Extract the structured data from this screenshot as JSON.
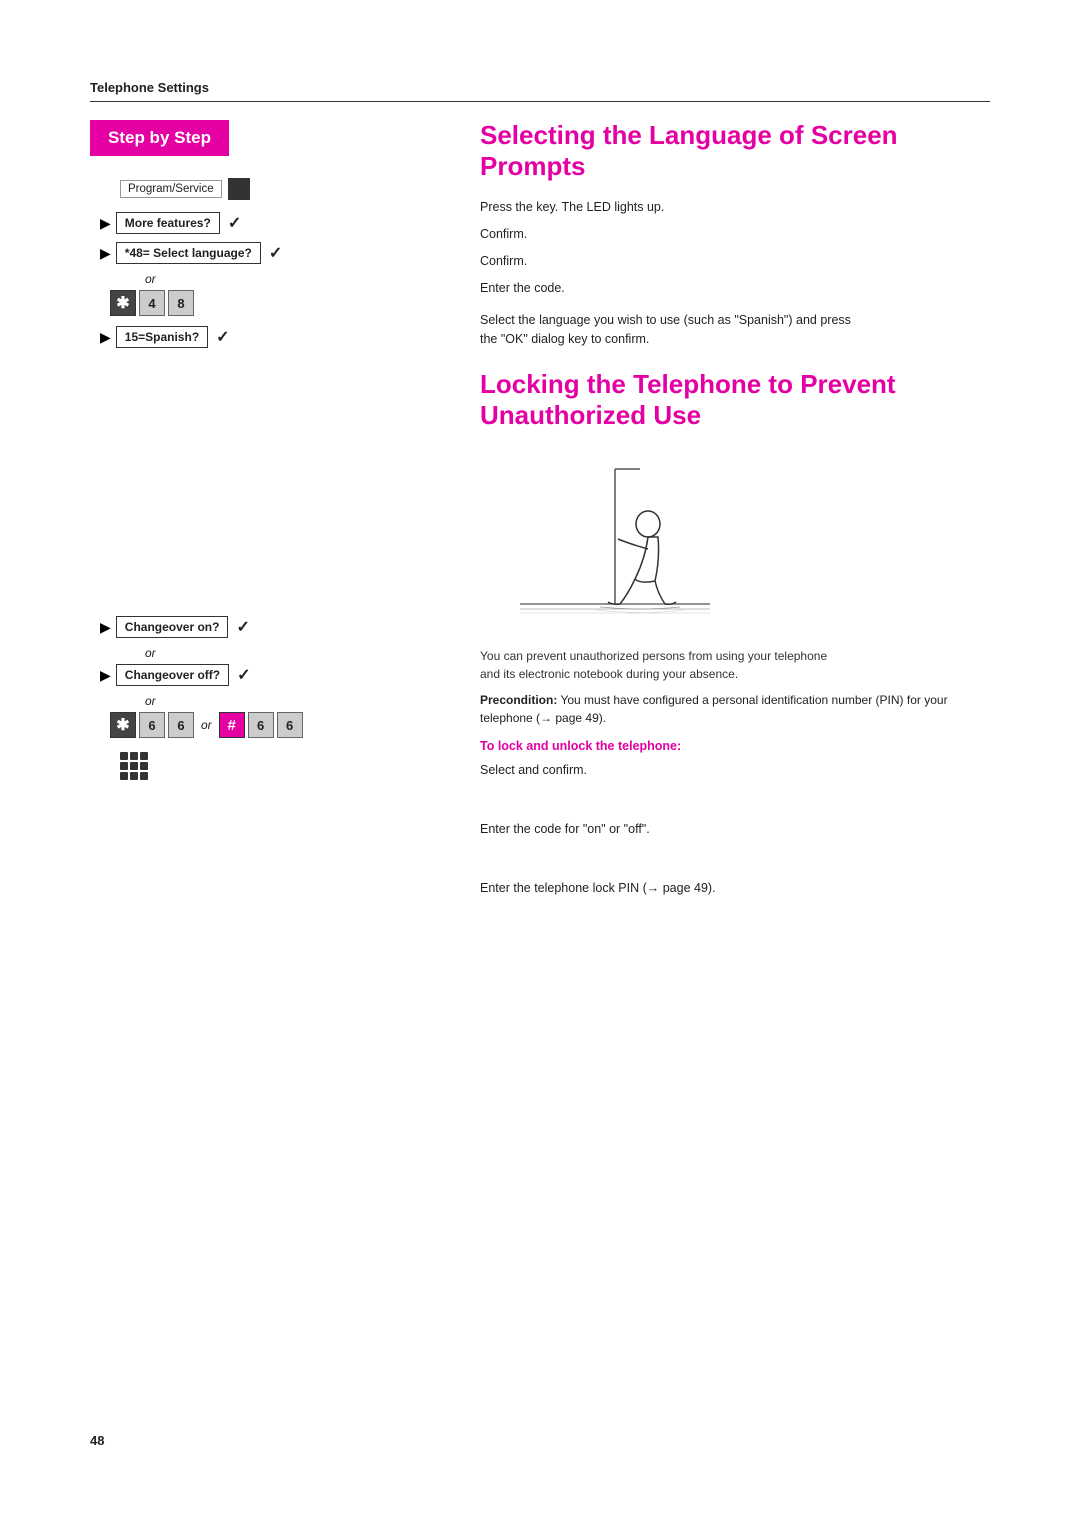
{
  "header": {
    "title": "Telephone Settings"
  },
  "left": {
    "banner": "Step by Step",
    "program_service_label": "Program/Service",
    "more_features_label": "More features?",
    "select_language_label": "*48= Select language?",
    "or_text": "or",
    "code_row1": [
      "*",
      "4",
      "8"
    ],
    "spanish_label": "15=Spanish?",
    "changeover_on_label": "Changeover on?",
    "changeover_off_label": "Changeover off?",
    "code_row2_part1": [
      "*",
      "6",
      "6"
    ],
    "code_row2_or": "or",
    "code_row2_part2": [
      "#",
      "6",
      "6"
    ]
  },
  "right": {
    "section1_title_line1": "Selecting the Language of Screen",
    "section1_title_line2": "Prompts",
    "desc1": "Press the key. The LED lights up.",
    "desc2": "Confirm.",
    "desc3": "Confirm.",
    "desc4": "Enter the code.",
    "desc5_line1": "Select the language you wish to use (such as \"Spanish\") and press",
    "desc5_line2": "the \"OK\" dialog key to confirm.",
    "section2_title_line1": "Locking the Telephone to Prevent",
    "section2_title_line2": "Unauthorized Use",
    "body1_line1": "You can prevent unauthorized persons from using your telephone",
    "body1_line2": "and its electronic notebook during your absence.",
    "precondition_label": "Precondition:",
    "precondition_text": " You must have configured a personal identification number (PIN) for your telephone (→ page 49).",
    "to_lock_label": "To lock and unlock the telephone:",
    "select_confirm": "Select and confirm.",
    "enter_code": "Enter the code for \"on\" or \"off\".",
    "enter_pin": "Enter the telephone lock PIN (→ page 49)."
  },
  "page_number": "48"
}
